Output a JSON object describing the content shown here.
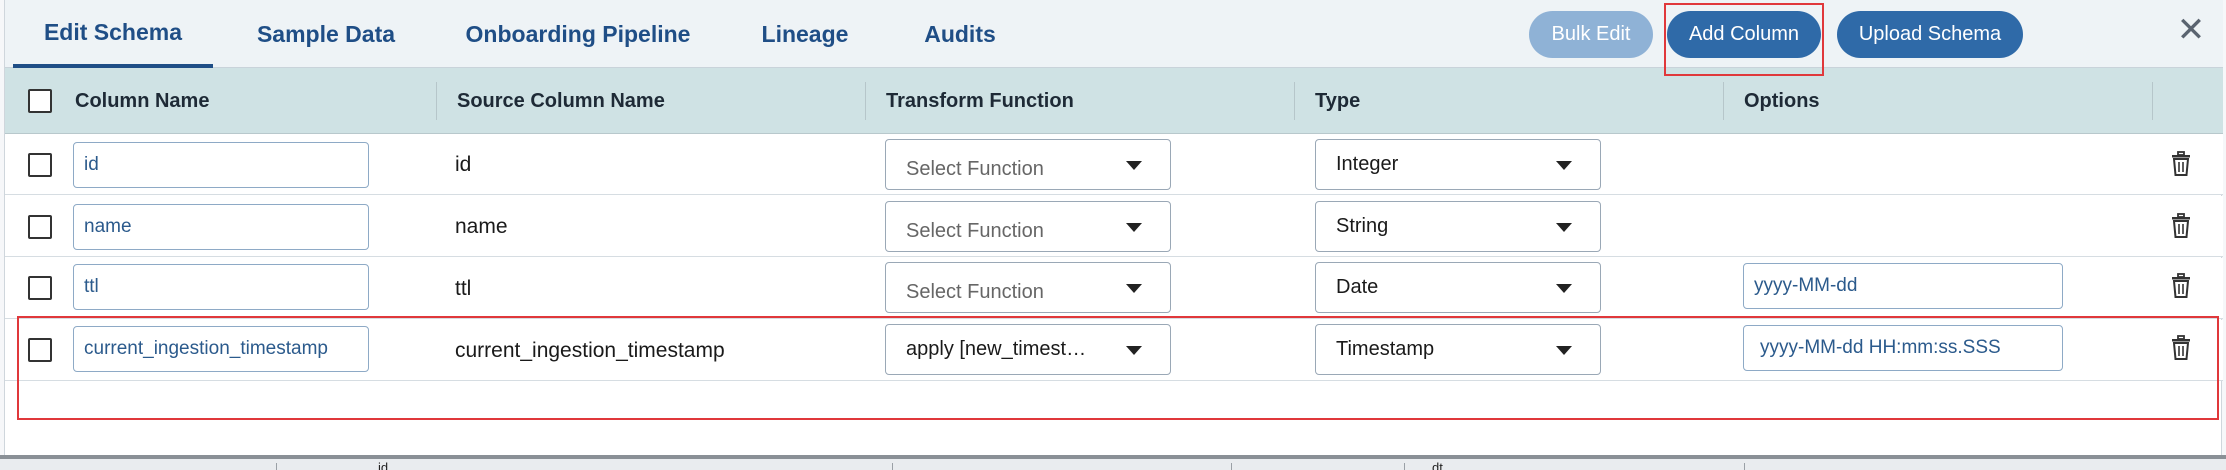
{
  "tabs": [
    {
      "label": "Edit Schema",
      "active": true
    },
    {
      "label": "Sample Data",
      "active": false
    },
    {
      "label": "Onboarding Pipeline",
      "active": false
    },
    {
      "label": "Lineage",
      "active": false
    },
    {
      "label": "Audits",
      "active": false
    }
  ],
  "toolbar": {
    "bulk_edit_label": "Bulk Edit",
    "add_column_label": "Add Column",
    "upload_schema_label": "Upload Schema",
    "close_symbol": "✕"
  },
  "table": {
    "headers": {
      "column_name": "Column Name",
      "source_column_name": "Source Column Name",
      "transform_function": "Transform Function",
      "type": "Type",
      "options": "Options"
    },
    "rows": [
      {
        "column_name": "id",
        "source_column_name": "id",
        "transform_function": "Select Function",
        "transform_is_placeholder": true,
        "type": "Integer",
        "options": ""
      },
      {
        "column_name": "name",
        "source_column_name": "name",
        "transform_function": "Select Function",
        "transform_is_placeholder": true,
        "type": "String",
        "options": ""
      },
      {
        "column_name": "ttl",
        "source_column_name": "ttl",
        "transform_function": "Select Function",
        "transform_is_placeholder": true,
        "type": "Date",
        "options": "yyyy-MM-dd"
      },
      {
        "column_name": "current_ingestion_timestamp",
        "source_column_name": "current_ingestion_timestamp",
        "transform_function": "apply [new_timest…",
        "transform_is_placeholder": false,
        "type": "Timestamp",
        "options": "yyyy-MM-dd HH:mm:ss.SSS"
      }
    ]
  },
  "background_table": {
    "fragments": [
      "id",
      "dt"
    ]
  },
  "colors": {
    "accent": "#1f4e86",
    "primary_button": "#2f6aa8",
    "disabled_button": "#8fb2d6",
    "header_bg": "#cfe2e4",
    "highlight": "#e0383b"
  },
  "icons": {
    "delete": "trash-icon",
    "close": "close-icon",
    "dropdown": "chevron-down-icon"
  }
}
